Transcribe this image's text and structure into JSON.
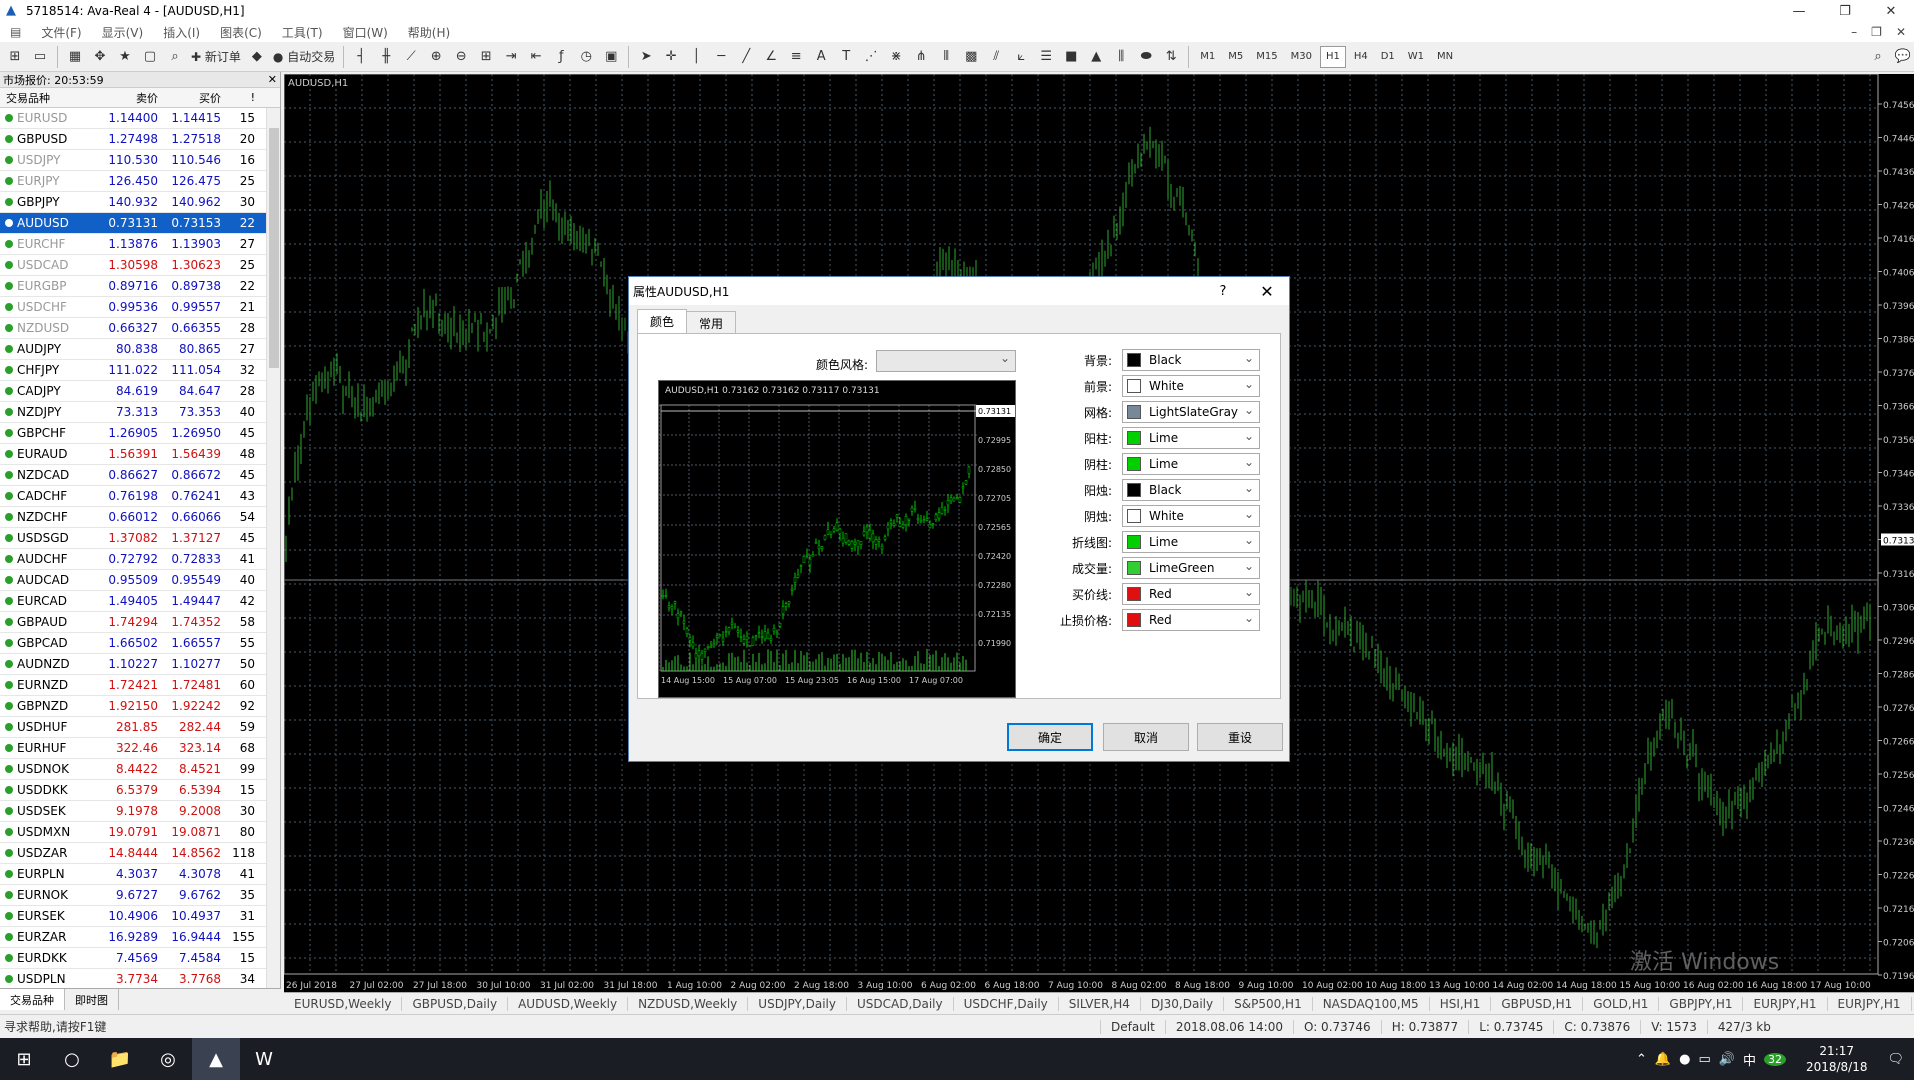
{
  "window": {
    "title": "5718514: Ava-Real 4 - [AUDUSD,H1]"
  },
  "menu": [
    "文件(F)",
    "显示(V)",
    "插入(I)",
    "图表(C)",
    "工具(T)",
    "窗口(W)",
    "帮助(H)"
  ],
  "toolbar": {
    "new_order": "新订单",
    "auto_trade": "自动交易",
    "timeframes": [
      "M1",
      "M5",
      "M15",
      "M30",
      "H1",
      "H4",
      "D1",
      "W1",
      "MN"
    ],
    "active_timeframe": "H1"
  },
  "market": {
    "header": "市场报价: 20:53:59",
    "columns": [
      "交易品种",
      "卖价",
      "买价",
      "!"
    ],
    "rows": [
      {
        "sym": "EURUSD",
        "bid": "1.14400",
        "ask": "1.14415",
        "spread": "15",
        "style": "grey",
        "bc": "blue",
        "ac": "blue"
      },
      {
        "sym": "GBPUSD",
        "bid": "1.27498",
        "ask": "1.27518",
        "spread": "20",
        "style": "",
        "bc": "blue",
        "ac": "blue"
      },
      {
        "sym": "USDJPY",
        "bid": "110.530",
        "ask": "110.546",
        "spread": "16",
        "style": "grey",
        "bc": "blue",
        "ac": "blue"
      },
      {
        "sym": "EURJPY",
        "bid": "126.450",
        "ask": "126.475",
        "spread": "25",
        "style": "grey",
        "bc": "blue",
        "ac": "blue"
      },
      {
        "sym": "GBPJPY",
        "bid": "140.932",
        "ask": "140.962",
        "spread": "30",
        "style": "",
        "bc": "blue",
        "ac": "blue"
      },
      {
        "sym": "AUDUSD",
        "bid": "0.73131",
        "ask": "0.73153",
        "spread": "22",
        "style": "sel",
        "bc": "blue",
        "ac": "blue"
      },
      {
        "sym": "EURCHF",
        "bid": "1.13876",
        "ask": "1.13903",
        "spread": "27",
        "style": "grey",
        "bc": "blue",
        "ac": "blue"
      },
      {
        "sym": "USDCAD",
        "bid": "1.30598",
        "ask": "1.30623",
        "spread": "25",
        "style": "grey",
        "bc": "red",
        "ac": "red"
      },
      {
        "sym": "EURGBP",
        "bid": "0.89716",
        "ask": "0.89738",
        "spread": "22",
        "style": "grey",
        "bc": "blue",
        "ac": "blue"
      },
      {
        "sym": "USDCHF",
        "bid": "0.99536",
        "ask": "0.99557",
        "spread": "21",
        "style": "grey",
        "bc": "blue",
        "ac": "blue"
      },
      {
        "sym": "NZDUSD",
        "bid": "0.66327",
        "ask": "0.66355",
        "spread": "28",
        "style": "grey",
        "bc": "blue",
        "ac": "blue"
      },
      {
        "sym": "AUDJPY",
        "bid": "80.838",
        "ask": "80.865",
        "spread": "27",
        "style": "",
        "bc": "blue",
        "ac": "blue"
      },
      {
        "sym": "CHFJPY",
        "bid": "111.022",
        "ask": "111.054",
        "spread": "32",
        "style": "",
        "bc": "blue",
        "ac": "blue"
      },
      {
        "sym": "CADJPY",
        "bid": "84.619",
        "ask": "84.647",
        "spread": "28",
        "style": "",
        "bc": "blue",
        "ac": "blue"
      },
      {
        "sym": "NZDJPY",
        "bid": "73.313",
        "ask": "73.353",
        "spread": "40",
        "style": "",
        "bc": "blue",
        "ac": "blue"
      },
      {
        "sym": "GBPCHF",
        "bid": "1.26905",
        "ask": "1.26950",
        "spread": "45",
        "style": "",
        "bc": "blue",
        "ac": "blue"
      },
      {
        "sym": "EURAUD",
        "bid": "1.56391",
        "ask": "1.56439",
        "spread": "48",
        "style": "",
        "bc": "red",
        "ac": "red"
      },
      {
        "sym": "NZDCAD",
        "bid": "0.86627",
        "ask": "0.86672",
        "spread": "45",
        "style": "",
        "bc": "blue",
        "ac": "blue"
      },
      {
        "sym": "CADCHF",
        "bid": "0.76198",
        "ask": "0.76241",
        "spread": "43",
        "style": "",
        "bc": "blue",
        "ac": "blue"
      },
      {
        "sym": "NZDCHF",
        "bid": "0.66012",
        "ask": "0.66066",
        "spread": "54",
        "style": "",
        "bc": "blue",
        "ac": "blue"
      },
      {
        "sym": "USDSGD",
        "bid": "1.37082",
        "ask": "1.37127",
        "spread": "45",
        "style": "",
        "bc": "red",
        "ac": "red"
      },
      {
        "sym": "AUDCHF",
        "bid": "0.72792",
        "ask": "0.72833",
        "spread": "41",
        "style": "",
        "bc": "blue",
        "ac": "blue"
      },
      {
        "sym": "AUDCAD",
        "bid": "0.95509",
        "ask": "0.95549",
        "spread": "40",
        "style": "",
        "bc": "blue",
        "ac": "blue"
      },
      {
        "sym": "EURCAD",
        "bid": "1.49405",
        "ask": "1.49447",
        "spread": "42",
        "style": "",
        "bc": "blue",
        "ac": "blue"
      },
      {
        "sym": "GBPAUD",
        "bid": "1.74294",
        "ask": "1.74352",
        "spread": "58",
        "style": "",
        "bc": "red",
        "ac": "red"
      },
      {
        "sym": "GBPCAD",
        "bid": "1.66502",
        "ask": "1.66557",
        "spread": "55",
        "style": "",
        "bc": "blue",
        "ac": "blue"
      },
      {
        "sym": "AUDNZD",
        "bid": "1.10227",
        "ask": "1.10277",
        "spread": "50",
        "style": "",
        "bc": "blue",
        "ac": "blue"
      },
      {
        "sym": "EURNZD",
        "bid": "1.72421",
        "ask": "1.72481",
        "spread": "60",
        "style": "",
        "bc": "red",
        "ac": "red"
      },
      {
        "sym": "GBPNZD",
        "bid": "1.92150",
        "ask": "1.92242",
        "spread": "92",
        "style": "",
        "bc": "red",
        "ac": "red"
      },
      {
        "sym": "USDHUF",
        "bid": "281.85",
        "ask": "282.44",
        "spread": "59",
        "style": "",
        "bc": "red",
        "ac": "red"
      },
      {
        "sym": "EURHUF",
        "bid": "322.46",
        "ask": "323.14",
        "spread": "68",
        "style": "",
        "bc": "red",
        "ac": "red"
      },
      {
        "sym": "USDNOK",
        "bid": "8.4422",
        "ask": "8.4521",
        "spread": "99",
        "style": "",
        "bc": "red",
        "ac": "red"
      },
      {
        "sym": "USDDKK",
        "bid": "6.5379",
        "ask": "6.5394",
        "spread": "15",
        "style": "",
        "bc": "red",
        "ac": "red"
      },
      {
        "sym": "USDSEK",
        "bid": "9.1978",
        "ask": "9.2008",
        "spread": "30",
        "style": "",
        "bc": "red",
        "ac": "red"
      },
      {
        "sym": "USDMXN",
        "bid": "19.0791",
        "ask": "19.0871",
        "spread": "80",
        "style": "",
        "bc": "red",
        "ac": "red"
      },
      {
        "sym": "USDZAR",
        "bid": "14.8444",
        "ask": "14.8562",
        "spread": "118",
        "style": "",
        "bc": "red",
        "ac": "red"
      },
      {
        "sym": "EURPLN",
        "bid": "4.3037",
        "ask": "4.3078",
        "spread": "41",
        "style": "",
        "bc": "blue",
        "ac": "blue"
      },
      {
        "sym": "EURNOK",
        "bid": "9.6727",
        "ask": "9.6762",
        "spread": "35",
        "style": "",
        "bc": "blue",
        "ac": "blue"
      },
      {
        "sym": "EURSEK",
        "bid": "10.4906",
        "ask": "10.4937",
        "spread": "31",
        "style": "",
        "bc": "blue",
        "ac": "blue"
      },
      {
        "sym": "EURZAR",
        "bid": "16.9289",
        "ask": "16.9444",
        "spread": "155",
        "style": "",
        "bc": "blue",
        "ac": "blue"
      },
      {
        "sym": "EURDKK",
        "bid": "7.4569",
        "ask": "7.4584",
        "spread": "15",
        "style": "",
        "bc": "blue",
        "ac": "blue"
      },
      {
        "sym": "USDPLN",
        "bid": "3.7734",
        "ask": "3.7768",
        "spread": "34",
        "style": "",
        "bc": "red",
        "ac": "red"
      }
    ],
    "tabs": [
      "交易品种",
      "即时图"
    ]
  },
  "chart": {
    "label": "AUDUSD,H1",
    "y_ticks": [
      "0.74560",
      "0.74460",
      "0.74360",
      "0.74260",
      "0.74160",
      "0.74060",
      "0.73960",
      "0.73860",
      "0.73760",
      "0.73660",
      "0.73560",
      "0.73460",
      "0.73360",
      "0.73131",
      "0.73160",
      "0.73060",
      "0.72960",
      "0.72860",
      "0.72760",
      "0.72660",
      "0.72560",
      "0.72460",
      "0.72360",
      "0.72260",
      "0.72160",
      "0.72060",
      "0.71960"
    ],
    "current_price": "0.73131",
    "x_ticks": [
      "26 Jul 2018",
      "27 Jul 02:00",
      "27 Jul 18:00",
      "30 Jul 10:00",
      "31 Jul 02:00",
      "31 Jul 18:00",
      "1 Aug 10:00",
      "2 Aug 02:00",
      "2 Aug 18:00",
      "3 Aug 10:00",
      "6 Aug 02:00",
      "6 Aug 18:00",
      "7 Aug 10:00",
      "8 Aug 02:00",
      "8 Aug 18:00",
      "9 Aug 10:00",
      "10 Aug 02:00",
      "10 Aug 18:00",
      "13 Aug 10:00",
      "14 Aug 02:00",
      "14 Aug 18:00",
      "15 Aug 10:00",
      "16 Aug 02:00",
      "16 Aug 18:00",
      "17 Aug 10:00"
    ],
    "candle_color": "#2ea82e"
  },
  "chart_tabs": [
    "EURUSD,Weekly",
    "GBPUSD,Daily",
    "AUDUSD,Weekly",
    "NZDUSD,Weekly",
    "USDJPY,Daily",
    "USDCAD,Daily",
    "USDCHF,Daily",
    "SILVER,H4",
    "DJ30,Daily",
    "S&P500,H1",
    "NASDAQ100,M5",
    "HSI,H1",
    "GBPUSD,H1",
    "GOLD,H1",
    "GBPJPY,H1",
    "EURJPY,H1",
    "EURJPY,H1"
  ],
  "status": {
    "help": "寻求帮助,请按F1键",
    "profile": "Default",
    "time": "2018.08.06 14:00",
    "open": "O: 0.73746",
    "high": "H: 0.73877",
    "low": "L: 0.73745",
    "close": "C: 0.73876",
    "volume": "V: 1573",
    "traffic": "427/3 kb"
  },
  "watermark": "激活 Windows",
  "taskbar": {
    "time": "21:17",
    "date": "2018/8/18",
    "ime": "中",
    "badge": "32"
  },
  "dialog": {
    "title": "属性AUDUSD,H1",
    "tabs": [
      "颜色",
      "常用"
    ],
    "scheme_label": "颜色风格:",
    "preview": {
      "header": "AUDUSD,H1  0.73162 0.73162 0.73117 0.73131",
      "y_ticks": [
        "0.73131",
        "0.72995",
        "0.72850",
        "0.72705",
        "0.72565",
        "0.72420",
        "0.72280",
        "0.72135",
        "0.71990"
      ],
      "x_ticks": [
        "14 Aug 15:00",
        "15 Aug 07:00",
        "15 Aug 23:05",
        "16 Aug 15:00",
        "17 Aug 07:00"
      ]
    },
    "colors": [
      {
        "label": "背景:",
        "value": "Black",
        "hex": "#000000"
      },
      {
        "label": "前景:",
        "value": "White",
        "hex": "#ffffff"
      },
      {
        "label": "网格:",
        "value": "LightSlateGray",
        "hex": "#778899"
      },
      {
        "label": "阳柱:",
        "value": "Lime",
        "hex": "#00d000"
      },
      {
        "label": "阴柱:",
        "value": "Lime",
        "hex": "#00d000"
      },
      {
        "label": "阳烛:",
        "value": "Black",
        "hex": "#000000"
      },
      {
        "label": "阴烛:",
        "value": "White",
        "hex": "#ffffff"
      },
      {
        "label": "折线图:",
        "value": "Lime",
        "hex": "#00d000"
      },
      {
        "label": "成交量:",
        "value": "LimeGreen",
        "hex": "#32cd32"
      },
      {
        "label": "买价线:",
        "value": "Red",
        "hex": "#e01010"
      },
      {
        "label": "止损价格:",
        "value": "Red",
        "hex": "#e01010"
      }
    ],
    "buttons": {
      "ok": "确定",
      "cancel": "取消",
      "reset": "重设"
    }
  }
}
